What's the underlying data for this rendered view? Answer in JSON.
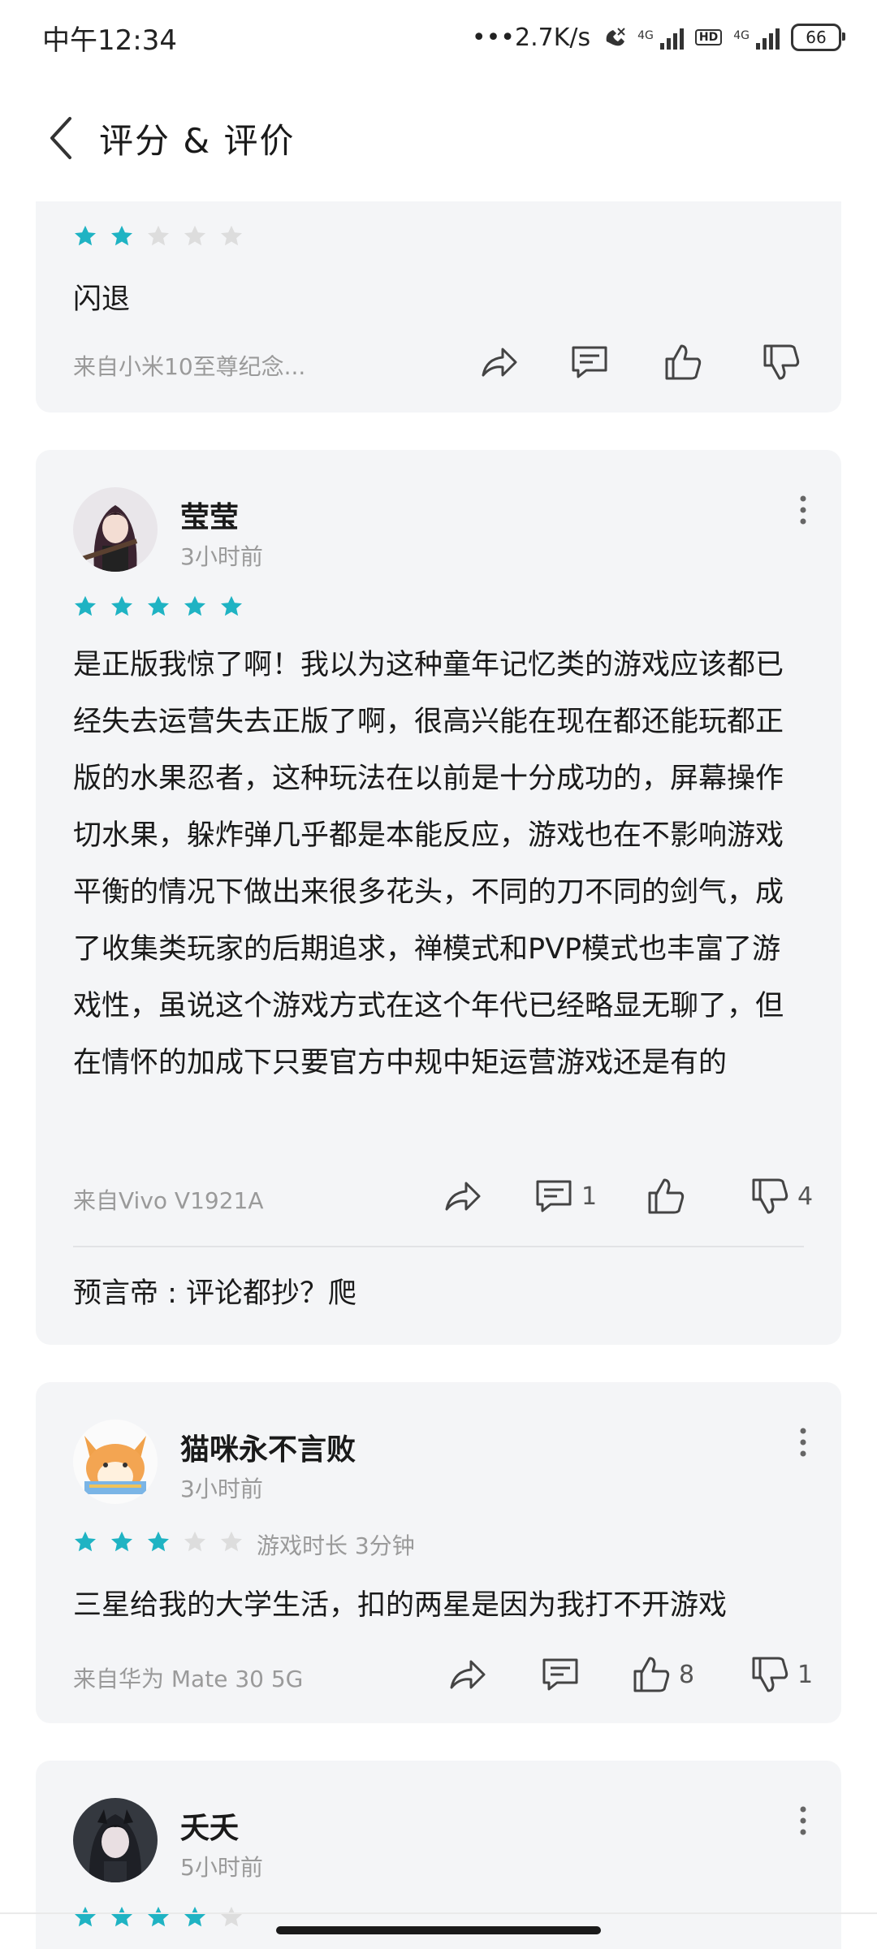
{
  "status_bar": {
    "time": "中午12:34",
    "net_speed": "•••2.7K/s",
    "net1": "4G",
    "hd": "HD",
    "net2": "4G",
    "battery": "66"
  },
  "header": {
    "title": "评分 & 评价"
  },
  "colors": {
    "star_on": "#1fb3c3",
    "star_off": "#dddddd",
    "card_bg": "#f4f5f7"
  },
  "reviews": [
    {
      "rating": 2,
      "text": "闪退",
      "device": "来自小米10至尊纪念...",
      "comment_count": "",
      "like_count": "",
      "dislike_count": ""
    },
    {
      "user": "莹莹",
      "time": "3小时前",
      "rating": 5,
      "text": "是正版我惊了啊！我以为这种童年记忆类的游戏应该都已经失去运营失去正版了啊，很高兴能在现在都还能玩都正版的水果忍者，这种玩法在以前是十分成功的，屏幕操作切水果，躲炸弹几乎都是本能反应，游戏也在不影响游戏平衡的情况下做出来很多花头，不同的刀不同的剑气，成了收集类玩家的后期追求，禅模式和PVP模式也丰富了游戏性，虽说这个游戏方式在这个年代已经略显无聊了，但在情怀的加成下只要官方中规中矩运营游戏还是有的",
      "device": "来自Vivo V1921A",
      "comment_count": "1",
      "like_count": "",
      "dislike_count": "4",
      "reply": "预言帝 : 评论都抄？爬"
    },
    {
      "user": "猫咪永不言败",
      "time": "3小时前",
      "rating": 3,
      "playtime": "游戏时长 3分钟",
      "text": "三星给我的大学生活，扣的两星是因为我打不开游戏",
      "device": "来自华为 Mate 30 5G",
      "comment_count": "",
      "like_count": "8",
      "dislike_count": "1"
    },
    {
      "user": "夭夭",
      "time": "5小时前",
      "rating": 4
    }
  ],
  "icons": [
    "back-icon",
    "share-icon",
    "comment-icon",
    "thumb-up-icon",
    "thumb-down-icon",
    "more-icon",
    "star-icon",
    "avatar"
  ]
}
